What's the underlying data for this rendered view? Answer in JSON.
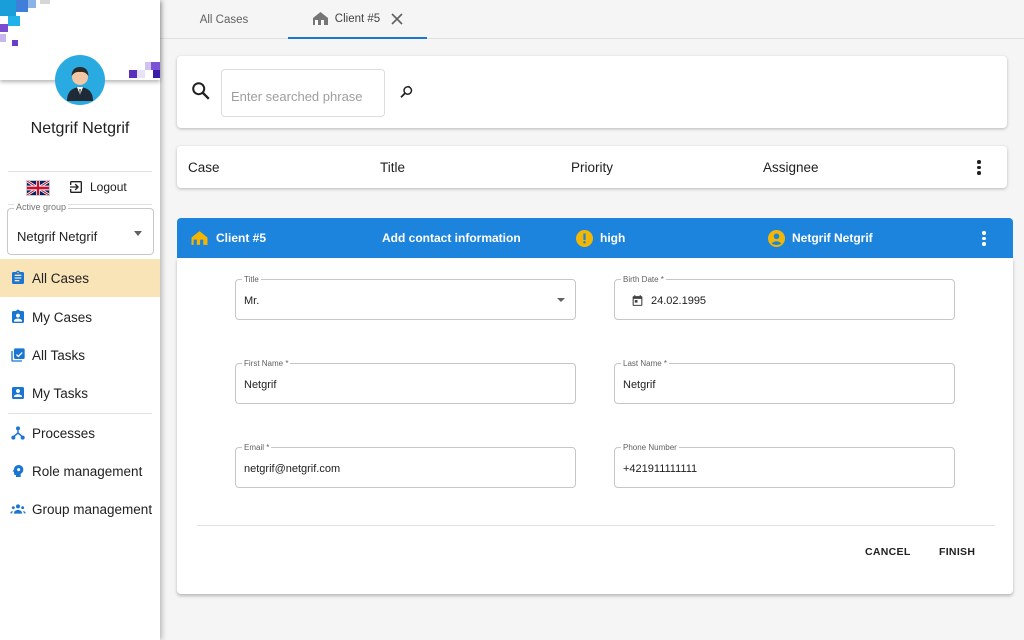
{
  "user": {
    "name": "Netgrif Netgrif"
  },
  "header": {
    "logout_label": "Logout",
    "language_icon": "uk-flag-icon"
  },
  "active_group": {
    "label": "Active group",
    "value": "Netgrif Netgrif"
  },
  "nav": {
    "items": [
      {
        "label": "All Cases",
        "icon": "clipboard-icon",
        "active": true
      },
      {
        "label": "My Cases",
        "icon": "assignment-ind-icon"
      },
      {
        "label": "All Tasks",
        "icon": "library-check-icon"
      },
      {
        "label": "My Tasks",
        "icon": "account-box-icon"
      },
      {
        "label": "Processes",
        "icon": "process-tree-icon"
      },
      {
        "label": "Role management",
        "icon": "role-icon"
      },
      {
        "label": "Group management",
        "icon": "group-icon"
      }
    ]
  },
  "tabs": [
    {
      "label": "All Cases"
    },
    {
      "label": "Client #5",
      "icon": "house-icon",
      "closable": true,
      "active": true
    }
  ],
  "search": {
    "placeholder": "Enter searched phrase"
  },
  "table_header": {
    "case": "Case",
    "title": "Title",
    "priority": "Priority",
    "assignee": "Assignee"
  },
  "case_row": {
    "case": "Client #5",
    "title": "Add contact information",
    "priority": "high",
    "assignee": "Netgrif Netgrif"
  },
  "form": {
    "title_field": {
      "label": "Title",
      "value": "Mr."
    },
    "birth_date": {
      "label": "Birth Date *",
      "value": "24.02.1995"
    },
    "first_name": {
      "label": "First Name *",
      "value": "Netgrif"
    },
    "last_name": {
      "label": "Last Name *",
      "value": "Netgrif"
    },
    "email": {
      "label": "Email *",
      "value": "netgrif@netgrif.com"
    },
    "phone": {
      "label": "Phone Number",
      "value": "+421911111111"
    }
  },
  "actions": {
    "cancel": "CANCEL",
    "finish": "FINISH"
  },
  "colors": {
    "accent": "#1c84dc",
    "active_nav": "#f9e4b7",
    "house": "#f5b400",
    "priority": "#f2b705"
  }
}
